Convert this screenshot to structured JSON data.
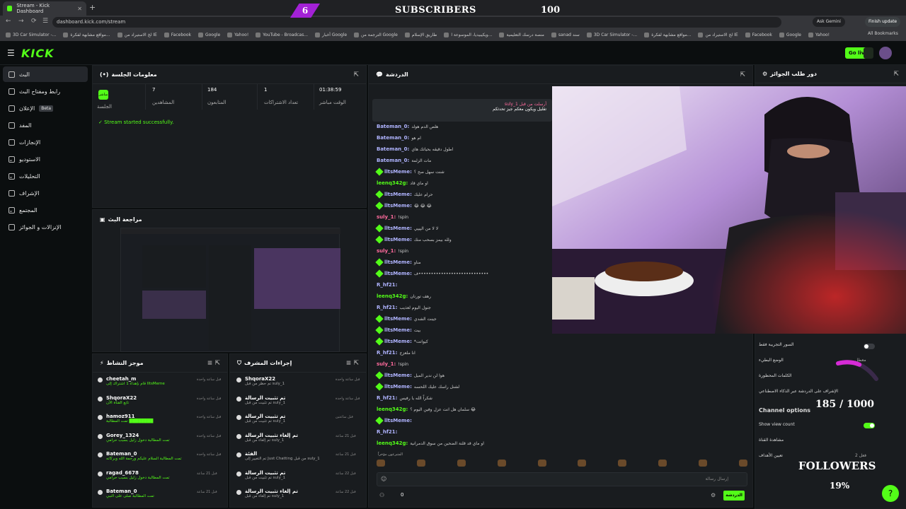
{
  "browser": {
    "tab_title": "Stream - Kick Dashboard",
    "url": "dashboard.kick.com/stream",
    "ask_gemini": "Ask Gemini",
    "finish_update": "Finish update",
    "all_bookmarks": "All Bookmarks",
    "bookmarks": [
      "3D Car Simulator -...",
      "مواقع مشابهة لفكرة...",
      "لخ الاستيراد من IE",
      "Facebook",
      "Google",
      "Yahoo!",
      "YouTube - Broadcas...",
      "أخبار Google",
      "الترجمة من Google",
      "طاريق الإسلام",
      "ويكيبيديا، الموسوعة ا...",
      "منصة درسك التعليمية",
      "sanad سند",
      "3D Car Simulator -...",
      "مواقع مشابهة لفكرة...",
      "لخ الاستيراد من IE",
      "Facebook",
      "Google",
      "Yahoo!"
    ]
  },
  "overlay": {
    "sub_count": "6",
    "sub_label": "SUBSCRIBERS",
    "sub_goal": "100",
    "followers_progress": "185 / 1000",
    "followers_label": "FOLLOWERS",
    "followers_percent": "19%",
    "followers_fraction": 0.19
  },
  "header": {
    "logo": "KICK",
    "go_live": "Go live"
  },
  "sidebar": {
    "items": [
      {
        "label": "البث",
        "active": true
      },
      {
        "label": "رابط ومفتاح البث"
      },
      {
        "label": "الإعلان",
        "badge": "Beta"
      },
      {
        "label": "المفد"
      },
      {
        "label": "الإنجازات"
      },
      {
        "label": "الاستوديو"
      },
      {
        "label": "التحليلات"
      },
      {
        "label": "الإشراف"
      },
      {
        "label": "المجتمع"
      },
      {
        "label": "الإنزالات و الجوائز"
      }
    ]
  },
  "session": {
    "title": "معلومات الجلسة",
    "live_tag": "مباشر",
    "session_label": "الجلسة",
    "stats": [
      {
        "value": "7",
        "label": "المشاهدين"
      },
      {
        "value": "184",
        "label": "المتابعون"
      },
      {
        "value": "1",
        "label": "تعداد الاشتراكات"
      },
      {
        "value": "01:38:59",
        "label": "الوقت مباشر"
      }
    ],
    "success": "Stream started successfully."
  },
  "preview": {
    "title": "مراجعة البث"
  },
  "activity": {
    "title": "موجز النشاط",
    "rows": [
      {
        "name": "cheetah_m",
        "msg": "قام بإهداء 1 اشتراك إلى lltsMeme",
        "time": "قبل ساعة واحدة"
      },
      {
        "name": "ShqoraX22",
        "msg": "تابع القناة الآن",
        "time": "قبل ساعة واحدة"
      },
      {
        "name": "hamoz911",
        "msg": "تمت المطالبة ████████",
        "time": "قبل ساعة واحدة"
      },
      {
        "name": "Gorey_1324",
        "msg": "تمت المطالبة دخول زليل بسبب حرامي",
        "time": "قبل ساعة واحدة"
      },
      {
        "name": "Bateman_0",
        "msg": "تمت المطالبة السلام عليكم ورحمة الله وبركاته",
        "time": "قبل ساعة واحدة"
      },
      {
        "name": "ragad_6678",
        "msg": "تمت المطالبة دخول زليل بسبب حرامي",
        "time": "قبل 21 ساعة"
      },
      {
        "name": "Bateman_0",
        "msg": "تمت المطالبة صلى على النبي",
        "time": "قبل 21 ساعة"
      }
    ]
  },
  "modactions": {
    "title": "إجراءات المشرف",
    "rows": [
      {
        "name": "ShqoraX22",
        "msg": "تم حظر من قبل suly_1",
        "time": "قبل ساعة واحدة"
      },
      {
        "name": "تم تثبيت الرسالة",
        "msg": "تم تثبيت من قبل suly_1",
        "time": "قبل ساعة واحدة"
      },
      {
        "name": "تم تثبيت الرسالة",
        "msg": "تم تثبيت من قبل suly_1",
        "time": "قبل ساعتين"
      },
      {
        "name": "تم إلغاء تثبيت الرسالة",
        "msg": "تم إلغاء من قبل suly_1",
        "time": "قبل 21 ساعة"
      },
      {
        "name": "الفئة",
        "msg": "تم التغيير إلى Just Chatting من قبل suly_1",
        "time": "قبل 21 ساعة"
      },
      {
        "name": "تم تثبيت الرسالة",
        "msg": "تم تثبيت من قبل suly_1",
        "time": "قبل 22 ساعة"
      },
      {
        "name": "تم إلغاء تثبيت الرسالة",
        "msg": "تم إلغاء من قبل suly_1",
        "time": "قبل 22 ساعة"
      }
    ]
  },
  "chat": {
    "title": "الدردشة",
    "pinned_by": "suly_1 أرسلت من قبل",
    "pinned_text": "تقليل ويكون معكم جيز تحدثكم",
    "lines": [
      {
        "user": "Bateman_0:",
        "text": "هلص الدم هولد",
        "color": "#b0b4ff"
      },
      {
        "user": "Bateman_0:",
        "text": "ام هو",
        "color": "#b0b4ff"
      },
      {
        "user": "Bateman_0:",
        "text": "اطول دقيقه بحياتك هاي",
        "color": "#b0b4ff"
      },
      {
        "user": "Bateman_0:",
        "text": "مات الزلمة",
        "color": "#b0b4ff"
      },
      {
        "user": "lltsMeme:",
        "text": "شنت سهل صح ؟",
        "color": "#b0b4ff",
        "badge": true
      },
      {
        "user": "leenq342g:",
        "text": "او ماي قاد",
        "color": "#53fc18"
      },
      {
        "user": "lltsMeme:",
        "text": "حرام عليك",
        "color": "#b0b4ff",
        "badge": true
      },
      {
        "user": "lltsMeme:",
        "text": "😂 😂 😂",
        "color": "#b0b4ff",
        "badge": true
      },
      {
        "user": "suly_1:",
        "text": "!spin",
        "color": "#ff6b9d"
      },
      {
        "user": "lltsMeme:",
        "text": "لا لا من الپيپي",
        "color": "#b0b4ff",
        "badge": true
      },
      {
        "user": "lltsMeme:",
        "text": "ولله بيمز بسحب منك",
        "color": "#b0b4ff",
        "badge": true
      },
      {
        "user": "suly_1:",
        "text": "!spin",
        "color": "#ff6b9d"
      },
      {
        "user": "lltsMeme:",
        "text": "مناو",
        "color": "#b0b4ff",
        "badge": true
      },
      {
        "user": "lltsMeme:",
        "text": "ف••••••••••••••••••••••••••••",
        "color": "#b0b4ff",
        "badge": true
      },
      {
        "user": "R_hf21:",
        "text": "",
        "color": "#b0b4ff"
      },
      {
        "user": "leenq342g:",
        "text": "رهف تورنان",
        "color": "#53fc18"
      },
      {
        "user": "R_hf21:",
        "text": "جنول اليوم لعذيب",
        "color": "#b0b4ff"
      },
      {
        "user": "lltsMeme:",
        "text": "جينت الشدي",
        "color": "#b0b4ff",
        "badge": true
      },
      {
        "user": "lltsMeme:",
        "text": "بيت",
        "color": "#b0b4ff",
        "badge": true
      },
      {
        "user": "lltsMeme:",
        "text": "*كيواتت",
        "color": "#b0b4ff",
        "badge": true
      },
      {
        "user": "R_hf21:",
        "text": "انا ملعزج",
        "color": "#b0b4ff"
      },
      {
        "user": "suly_1:",
        "text": "!spin",
        "color": "#ff6b9d"
      },
      {
        "user": "lltsMeme:",
        "text": "هوا لن ندير الميل",
        "color": "#b0b4ff",
        "badge": true
      },
      {
        "user": "lltsMeme:",
        "text": "لشنل راسك عليك اللحسه",
        "color": "#b0b4ff",
        "badge": true
      },
      {
        "user": "R_hf21:",
        "text": "شكراً الله يا رفيس",
        "color": "#b0b4ff"
      },
      {
        "user": "leenq342g:",
        "text": "سلمان هل انت عزل وفين اليوم ؟ 😂",
        "color": "#53fc18"
      },
      {
        "user": "lltsMeme:",
        "text": "",
        "color": "#b0b4ff",
        "badge": true
      },
      {
        "user": "R_hf21:",
        "text": "",
        "color": "#b0b4ff"
      },
      {
        "user": "leenq342g:",
        "text": "او ماي قد قلنة الضحين من سوق الدمرانية",
        "color": "#53fc18"
      }
    ],
    "input_placeholder": "إرسال رسالة",
    "send": "الدردشة",
    "viewers_label": "المتبرعون مؤخراً",
    "count": "0"
  },
  "right": {
    "title": "دور طلب الجوائز",
    "options": [
      {
        "label": "السور التجريبة فقط"
      },
      {
        "label": "الوضع البطيء",
        "value": "معطل"
      },
      {
        "label": "الكلمات المحظورة"
      },
      {
        "label": "الإشراف على الدردشة عبر الذكاء الاصطناعي"
      },
      {
        "label": "Channel options"
      },
      {
        "label": "Show view count"
      },
      {
        "label": "مشاهدة القناة"
      },
      {
        "label": "تعيين الأهداف",
        "value": "فعل 2"
      }
    ]
  }
}
